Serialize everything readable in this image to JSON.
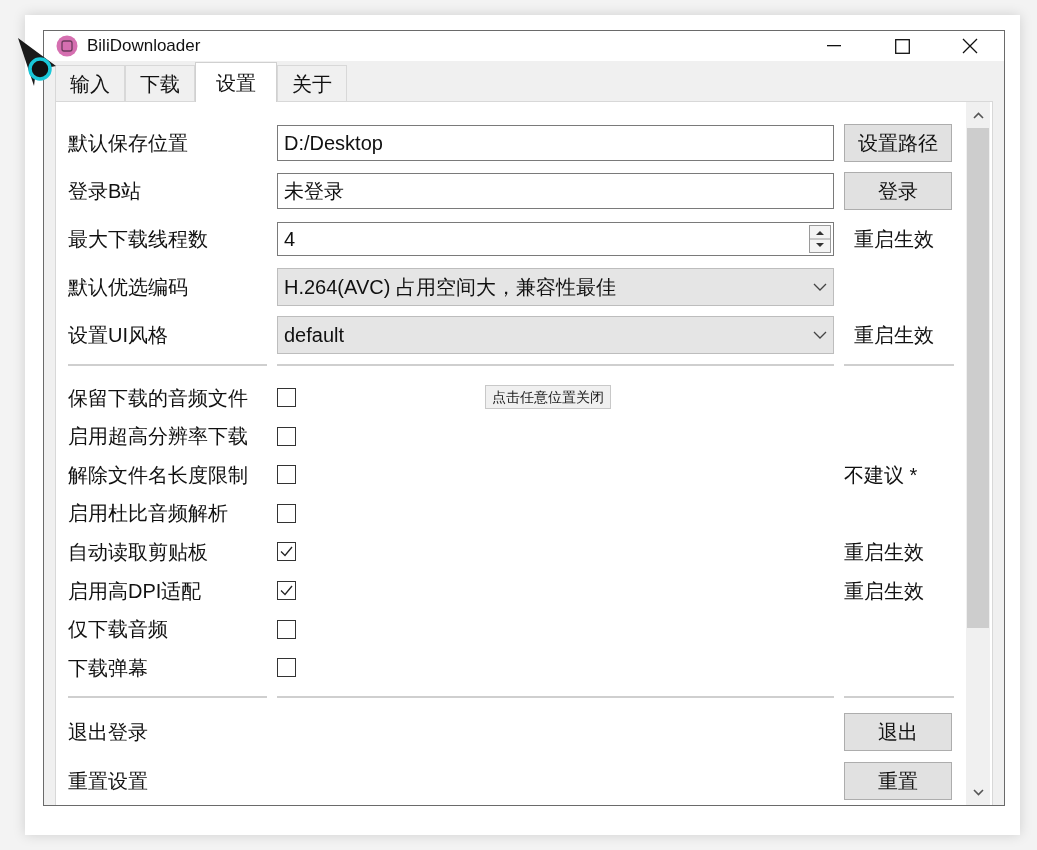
{
  "window": {
    "title": "BiliDownloader"
  },
  "tabs": [
    {
      "label": "输入",
      "selected": false
    },
    {
      "label": "下载",
      "selected": false
    },
    {
      "label": "设置",
      "selected": true
    },
    {
      "label": "关于",
      "selected": false
    }
  ],
  "field_rows": [
    {
      "label": "默认保存位置",
      "kind": "text",
      "value": "D:/Desktop",
      "button": "设置路径"
    },
    {
      "label": "登录B站",
      "kind": "text",
      "value": "未登录",
      "button": "登录"
    },
    {
      "label": "最大下载线程数",
      "kind": "spin",
      "value": "4",
      "note": "重启生效"
    },
    {
      "label": "默认优选编码",
      "kind": "select",
      "value": "H.264(AVC) 占用空间大，兼容性最佳"
    },
    {
      "label": "设置UI风格",
      "kind": "select",
      "value": "default",
      "note": "重启生效"
    }
  ],
  "tooltip": "点击任意位置关闭",
  "check_rows": [
    {
      "label": "保留下载的音频文件",
      "checked": false
    },
    {
      "label": "启用超高分辨率下载",
      "checked": false
    },
    {
      "label": "解除文件名长度限制",
      "checked": false,
      "note": "不建议 *"
    },
    {
      "label": "启用杜比音频解析",
      "checked": false
    },
    {
      "label": "自动读取剪贴板",
      "checked": true,
      "note": "重启生效"
    },
    {
      "label": "启用高DPI适配",
      "checked": true,
      "note": "重启生效"
    },
    {
      "label": "仅下载音频",
      "checked": false
    },
    {
      "label": "下载弹幕",
      "checked": false
    }
  ],
  "action_rows": [
    {
      "label": "退出登录",
      "button": "退出"
    },
    {
      "label": "重置设置",
      "button": "重置"
    }
  ]
}
